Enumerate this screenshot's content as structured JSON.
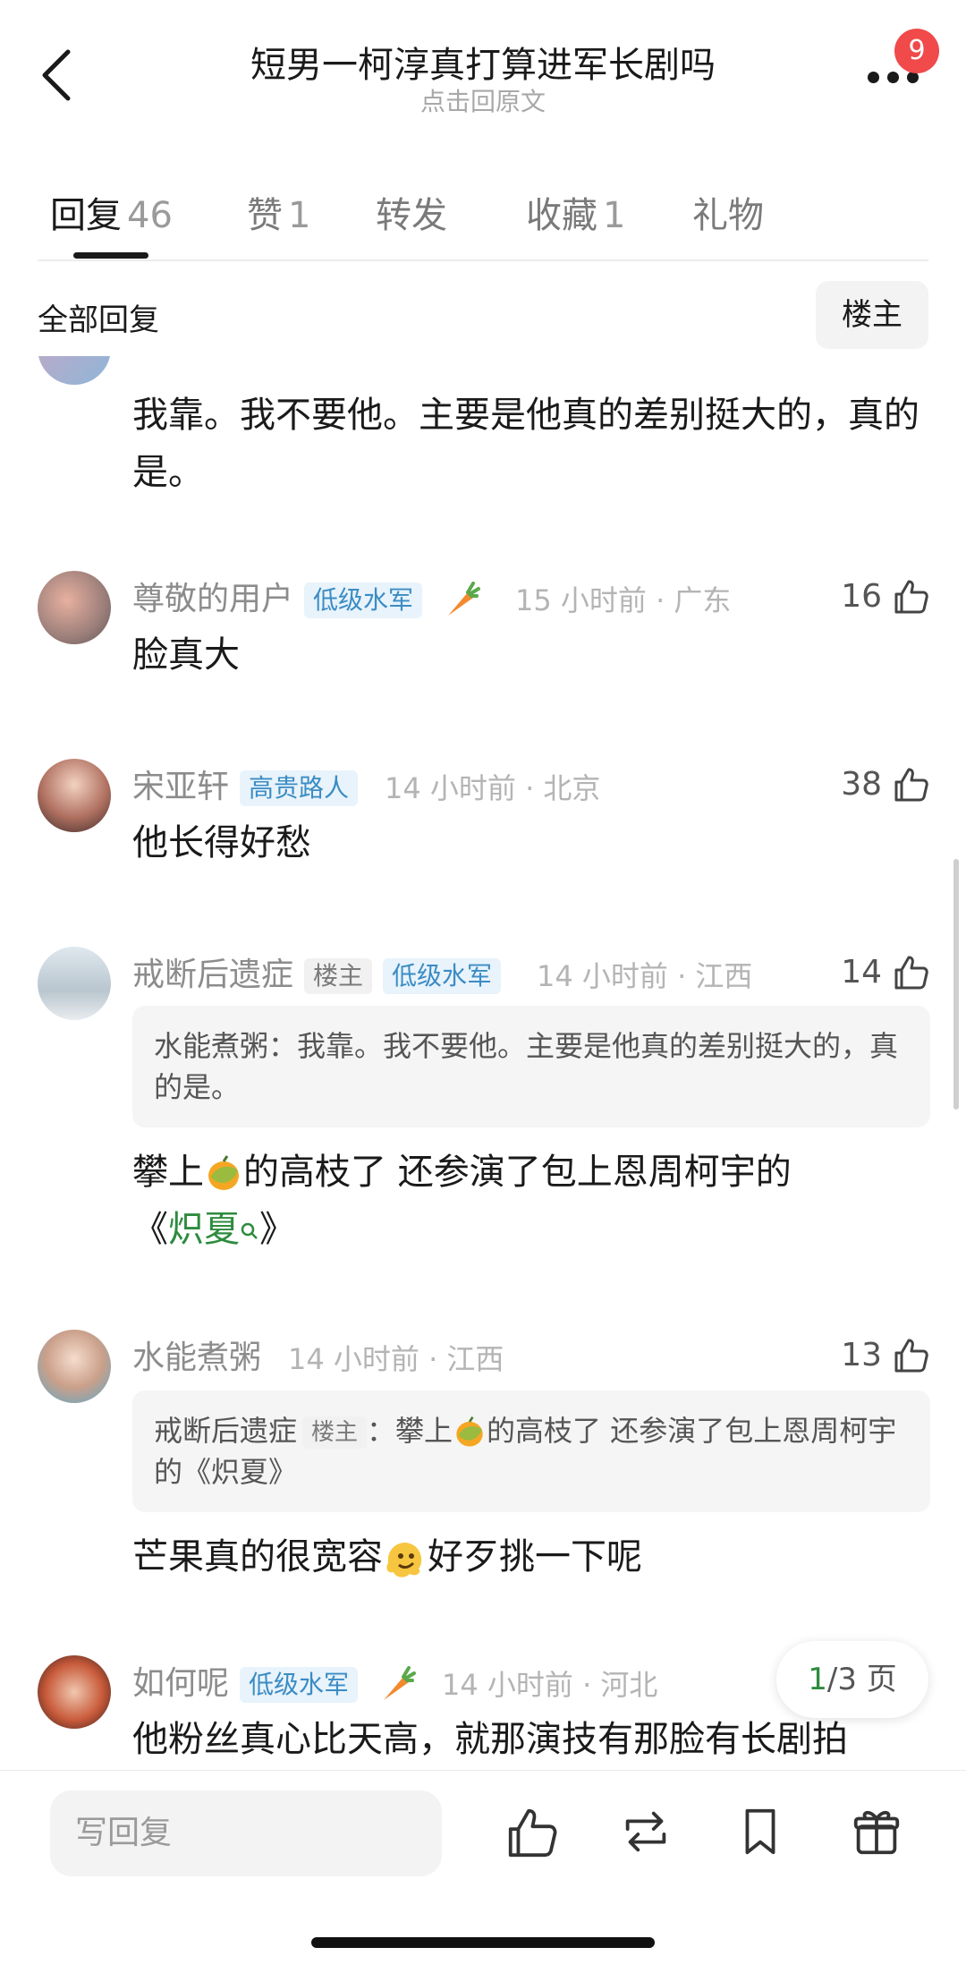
{
  "header": {
    "title": "短男一柯淳真打算进军长剧吗",
    "subtitle": "点击回原文",
    "badge": "9"
  },
  "tabs": [
    {
      "label": "回复",
      "count": "46"
    },
    {
      "label": "赞",
      "count": "1"
    },
    {
      "label": "转发",
      "count": ""
    },
    {
      "label": "收藏",
      "count": "1"
    },
    {
      "label": "礼物",
      "count": ""
    }
  ],
  "section": {
    "title": "全部回复",
    "op_filter": "楼主"
  },
  "comments": [
    {
      "text": "我靠。我不要他。主要是他真的差别挺大的，真的是。"
    },
    {
      "user": "尊敬的用户",
      "tag": "低级水军",
      "meta": "15 小时前 · 广东",
      "likes": "16",
      "text": "脸真大"
    },
    {
      "user": "宋亚轩",
      "tag": "高贵路人",
      "meta": "14 小时前 · 北京",
      "likes": "38",
      "text": "他长得好愁"
    },
    {
      "user": "戒断后遗症",
      "op_tag": "楼主",
      "tag": "低级水军",
      "meta": "14 小时前 · 江西",
      "likes": "14",
      "quote": "水能煮粥：我靠。我不要他。主要是他真的差别挺大的，真的是。",
      "text_a": "攀上",
      "text_b": "的高枝了 还参演了包上恩周柯宇的",
      "text_c": "《",
      "link": "炽夏",
      "text_d": "》"
    },
    {
      "user": "水能煮粥",
      "meta": "14 小时前 · 江西",
      "likes": "13",
      "quote_user": "戒断后遗症",
      "quote_tag": "楼主",
      "quote_a": "：攀上",
      "quote_b": "的高枝了 还参演了包上恩周柯宇的《炽夏》",
      "text_a": "芒果真的很宽容",
      "text_b": "好歹挑一下呢"
    },
    {
      "user": "如何呢",
      "tag": "低级水军",
      "meta": "14 小时前 · 河北",
      "text": "他粉丝真心比天高，就那演技有那脸有长剧拍"
    }
  ],
  "pager": {
    "current": "1",
    "rest": "/3 页"
  },
  "bottom": {
    "reply_placeholder": "写回复"
  }
}
